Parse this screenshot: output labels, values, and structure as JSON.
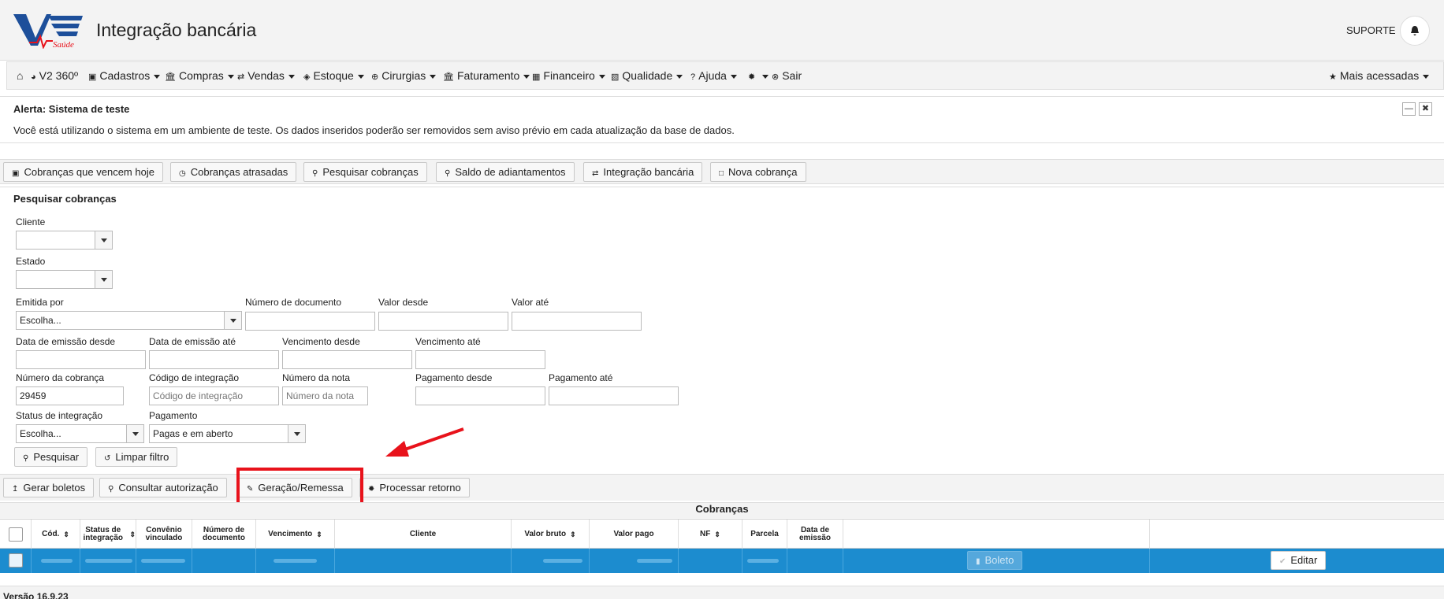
{
  "header": {
    "logo_text": "V2 Saúde",
    "title": "Integração bancária",
    "user": "SUPORTE"
  },
  "nav": [
    {
      "label": "V2 360º",
      "icon": "chart-pie-icon",
      "dropdown": false
    },
    {
      "label": "Cadastros",
      "icon": "save-icon",
      "dropdown": true
    },
    {
      "label": "Compras",
      "icon": "bank-icon",
      "dropdown": true
    },
    {
      "label": "Vendas",
      "icon": "exchange-icon",
      "dropdown": true
    },
    {
      "label": "Estoque",
      "icon": "tag-icon",
      "dropdown": true
    },
    {
      "label": "Cirurgias",
      "icon": "plus-circle-icon",
      "dropdown": true
    },
    {
      "label": "Faturamento",
      "icon": "bank-icon",
      "dropdown": true
    },
    {
      "label": "Financeiro",
      "icon": "calculator-icon",
      "dropdown": true
    },
    {
      "label": "Qualidade",
      "icon": "book-icon",
      "dropdown": true
    },
    {
      "label": "Ajuda",
      "icon": "question-icon",
      "dropdown": true
    },
    {
      "label": "",
      "icon": "gear-icon",
      "dropdown": true
    },
    {
      "label": "Sair",
      "icon": "close-circle-icon",
      "dropdown": false
    }
  ],
  "nav_right": "Mais acessadas",
  "alert": {
    "title": "Alerta: Sistema de teste",
    "message": "Você está utilizando o sistema em um ambiente de teste. Os dados inseridos poderão ser removidos sem aviso prévio em cada atualização da base de dados."
  },
  "tabs": [
    "Cobranças que vencem hoje",
    "Cobranças atrasadas",
    "Pesquisar cobranças",
    "Saldo de adiantamentos",
    "Integração bancária",
    "Nova cobrança"
  ],
  "search": {
    "title": "Pesquisar cobranças",
    "cliente_label": "Cliente",
    "estado_label": "Estado",
    "emitida_label": "Emitida por",
    "emitida_value": "Escolha...",
    "numdoc_label": "Número de documento",
    "valor_desde_label": "Valor desde",
    "valor_ate_label": "Valor até",
    "data_emissao_desde_label": "Data de emissão desde",
    "data_emissao_ate_label": "Data de emissão até",
    "vencimento_desde_label": "Vencimento desde",
    "vencimento_ate_label": "Vencimento até",
    "numero_cobranca_label": "Número da cobrança",
    "numero_cobranca_value": "29459",
    "codigo_integracao_label": "Código de integração",
    "codigo_integracao_placeholder": "Código de integração",
    "numero_nota_label": "Número da nota",
    "numero_nota_placeholder": "Número da nota",
    "pagamento_desde_label": "Pagamento desde",
    "pagamento_ate_label": "Pagamento até",
    "status_integracao_label": "Status de integração",
    "status_integracao_value": "Escolha...",
    "pagamento_label": "Pagamento",
    "pagamento_value": "Pagas e em aberto",
    "search_button": "Pesquisar",
    "clear_button": "Limpar filtro"
  },
  "actions": [
    "Gerar boletos",
    "Consultar autorização",
    "Geração/Remessa",
    "Processar retorno"
  ],
  "table": {
    "title": "Cobranças",
    "headers": [
      "Cód.",
      "Status de integração",
      "Convênio vinculado",
      "Número de documento",
      "Vencimento",
      "Cliente",
      "Valor bruto",
      "Valor pago",
      "NF",
      "Parcela",
      "Data de emissão"
    ],
    "row_button_boleto": "Boleto",
    "row_button_edit": "Editar"
  },
  "footer": {
    "version": "Versão 16.9.23"
  },
  "colors": {
    "selected_row": "#1c8ccf",
    "highlight": "#e8121b",
    "logo_blue": "#1d4f9a"
  }
}
